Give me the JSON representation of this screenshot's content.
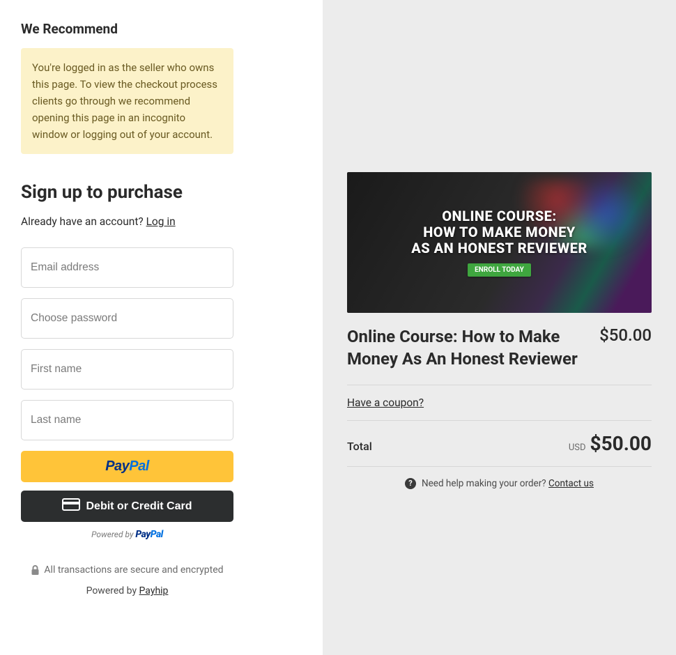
{
  "left": {
    "recommend_heading": "We Recommend",
    "info_text": "You're logged in as the seller who owns this page. To view the checkout process clients go through we recommend opening this page in an incognito window or logging out of your account.",
    "signup_heading": "Sign up to purchase",
    "login_prompt": "Already have an account? ",
    "login_link": "Log in",
    "fields": {
      "email": "Email address",
      "password": "Choose password",
      "first_name": "First name",
      "last_name": "Last name"
    },
    "paypal_label": "PayPal",
    "card_label": "Debit or Credit Card",
    "powered_paypal_prefix": "Powered by ",
    "secure_text": "All transactions are secure and encrypted",
    "powered_by_prefix": "Powered by ",
    "powered_by_link": "Payhip"
  },
  "right": {
    "image_title_line1": "ONLINE COURSE:",
    "image_title_line2": "HOW TO MAKE MONEY",
    "image_title_line3": "AS AN HONEST REVIEWER",
    "enroll_badge": "ENROLL TODAY",
    "product_title": "Online Course: How to Make Money As An Honest Reviewer",
    "product_price": "$50.00",
    "coupon_link": "Have a coupon?",
    "total_label": "Total",
    "total_currency": "USD",
    "total_amount": "$50.00",
    "help_text": "Need help making your order? ",
    "contact_link": "Contact us"
  }
}
